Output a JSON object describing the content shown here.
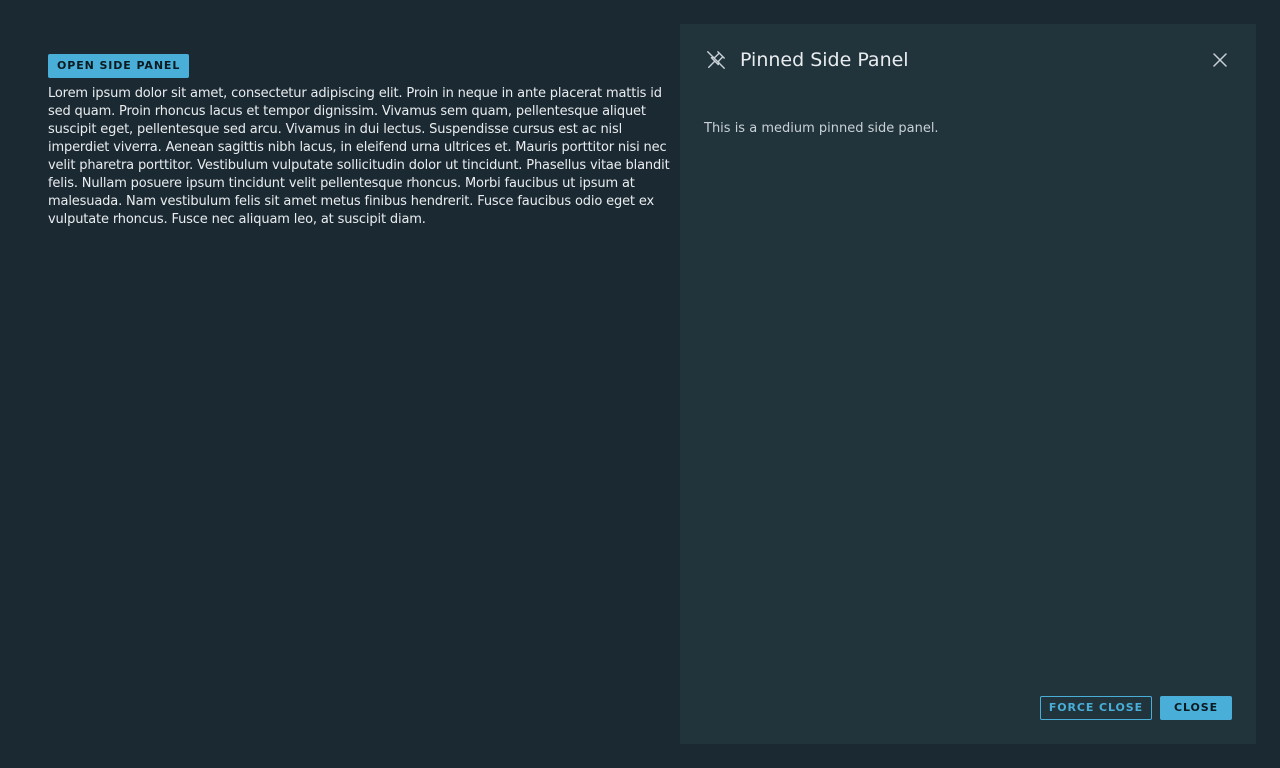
{
  "main": {
    "open_button_label": "OPEN SIDE PANEL",
    "lorem_text": "Lorem ipsum dolor sit amet, consectetur adipiscing elit. Proin in neque in ante placerat mattis id sed quam. Proin rhoncus lacus et tempor dignissim. Vivamus sem quam, pellentesque aliquet suscipit eget, pellentesque sed arcu. Vivamus in dui lectus. Suspendisse cursus est ac nisl imperdiet viverra. Aenean sagittis nibh lacus, in eleifend urna ultrices et. Mauris porttitor nisi nec velit pharetra porttitor. Vestibulum vulputate sollicitudin dolor ut tincidunt. Phasellus vitae blandit felis. Nullam posuere ipsum tincidunt velit pellentesque rhoncus. Morbi faucibus ut ipsum at malesuada. Nam vestibulum felis sit amet metus finibus hendrerit. Fusce faucibus odio eget ex vulputate rhoncus. Fusce nec aliquam leo, at suscipit diam."
  },
  "side_panel": {
    "title": "Pinned Side Panel",
    "body_text": "This is a medium pinned side panel.",
    "pin_icon": "unpin-icon",
    "close_icon": "close-icon",
    "footer": {
      "force_close_label": "FORCE CLOSE",
      "close_label": "CLOSE"
    }
  },
  "colors": {
    "background": "#1b2a32",
    "panel_background": "#21333b",
    "accent": "#49afd9",
    "text": "#e9ecef"
  }
}
